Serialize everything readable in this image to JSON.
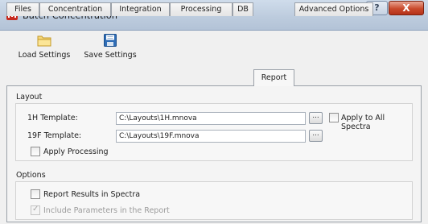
{
  "window": {
    "title": "Batch Concentration",
    "help_label": "?",
    "close_label": "X"
  },
  "toolbar": {
    "load_label": "Load Settings",
    "save_label": "Save Settings"
  },
  "tabs": [
    {
      "label": "Files"
    },
    {
      "label": "Concentration"
    },
    {
      "label": "Integration"
    },
    {
      "label": "Processing"
    },
    {
      "label": "DB"
    },
    {
      "label": "Report",
      "active": true
    },
    {
      "label": "Advanced Options"
    }
  ],
  "layout_group": {
    "title": "Layout",
    "template_1h_label": "1H Template:",
    "template_1h_value": "C:\\Layouts\\1H.mnova",
    "template_19f_label": "19F Template:",
    "template_19f_value": "C:\\Layouts\\19F.mnova",
    "browse_label": "...",
    "apply_all_label": "Apply to All Spectra",
    "apply_all_checked": false,
    "apply_processing_label": "Apply Processing",
    "apply_processing_checked": false
  },
  "options_group": {
    "title": "Options",
    "report_results_label": "Report Results in Spectra",
    "report_results_checked": false,
    "include_params_label": "Include Parameters in the Report",
    "include_params_checked": true,
    "include_params_enabled": false
  },
  "colors": {
    "titlebar": "#bccbdd",
    "close_button": "#c94a2c",
    "panel": "#f4f4f4"
  }
}
